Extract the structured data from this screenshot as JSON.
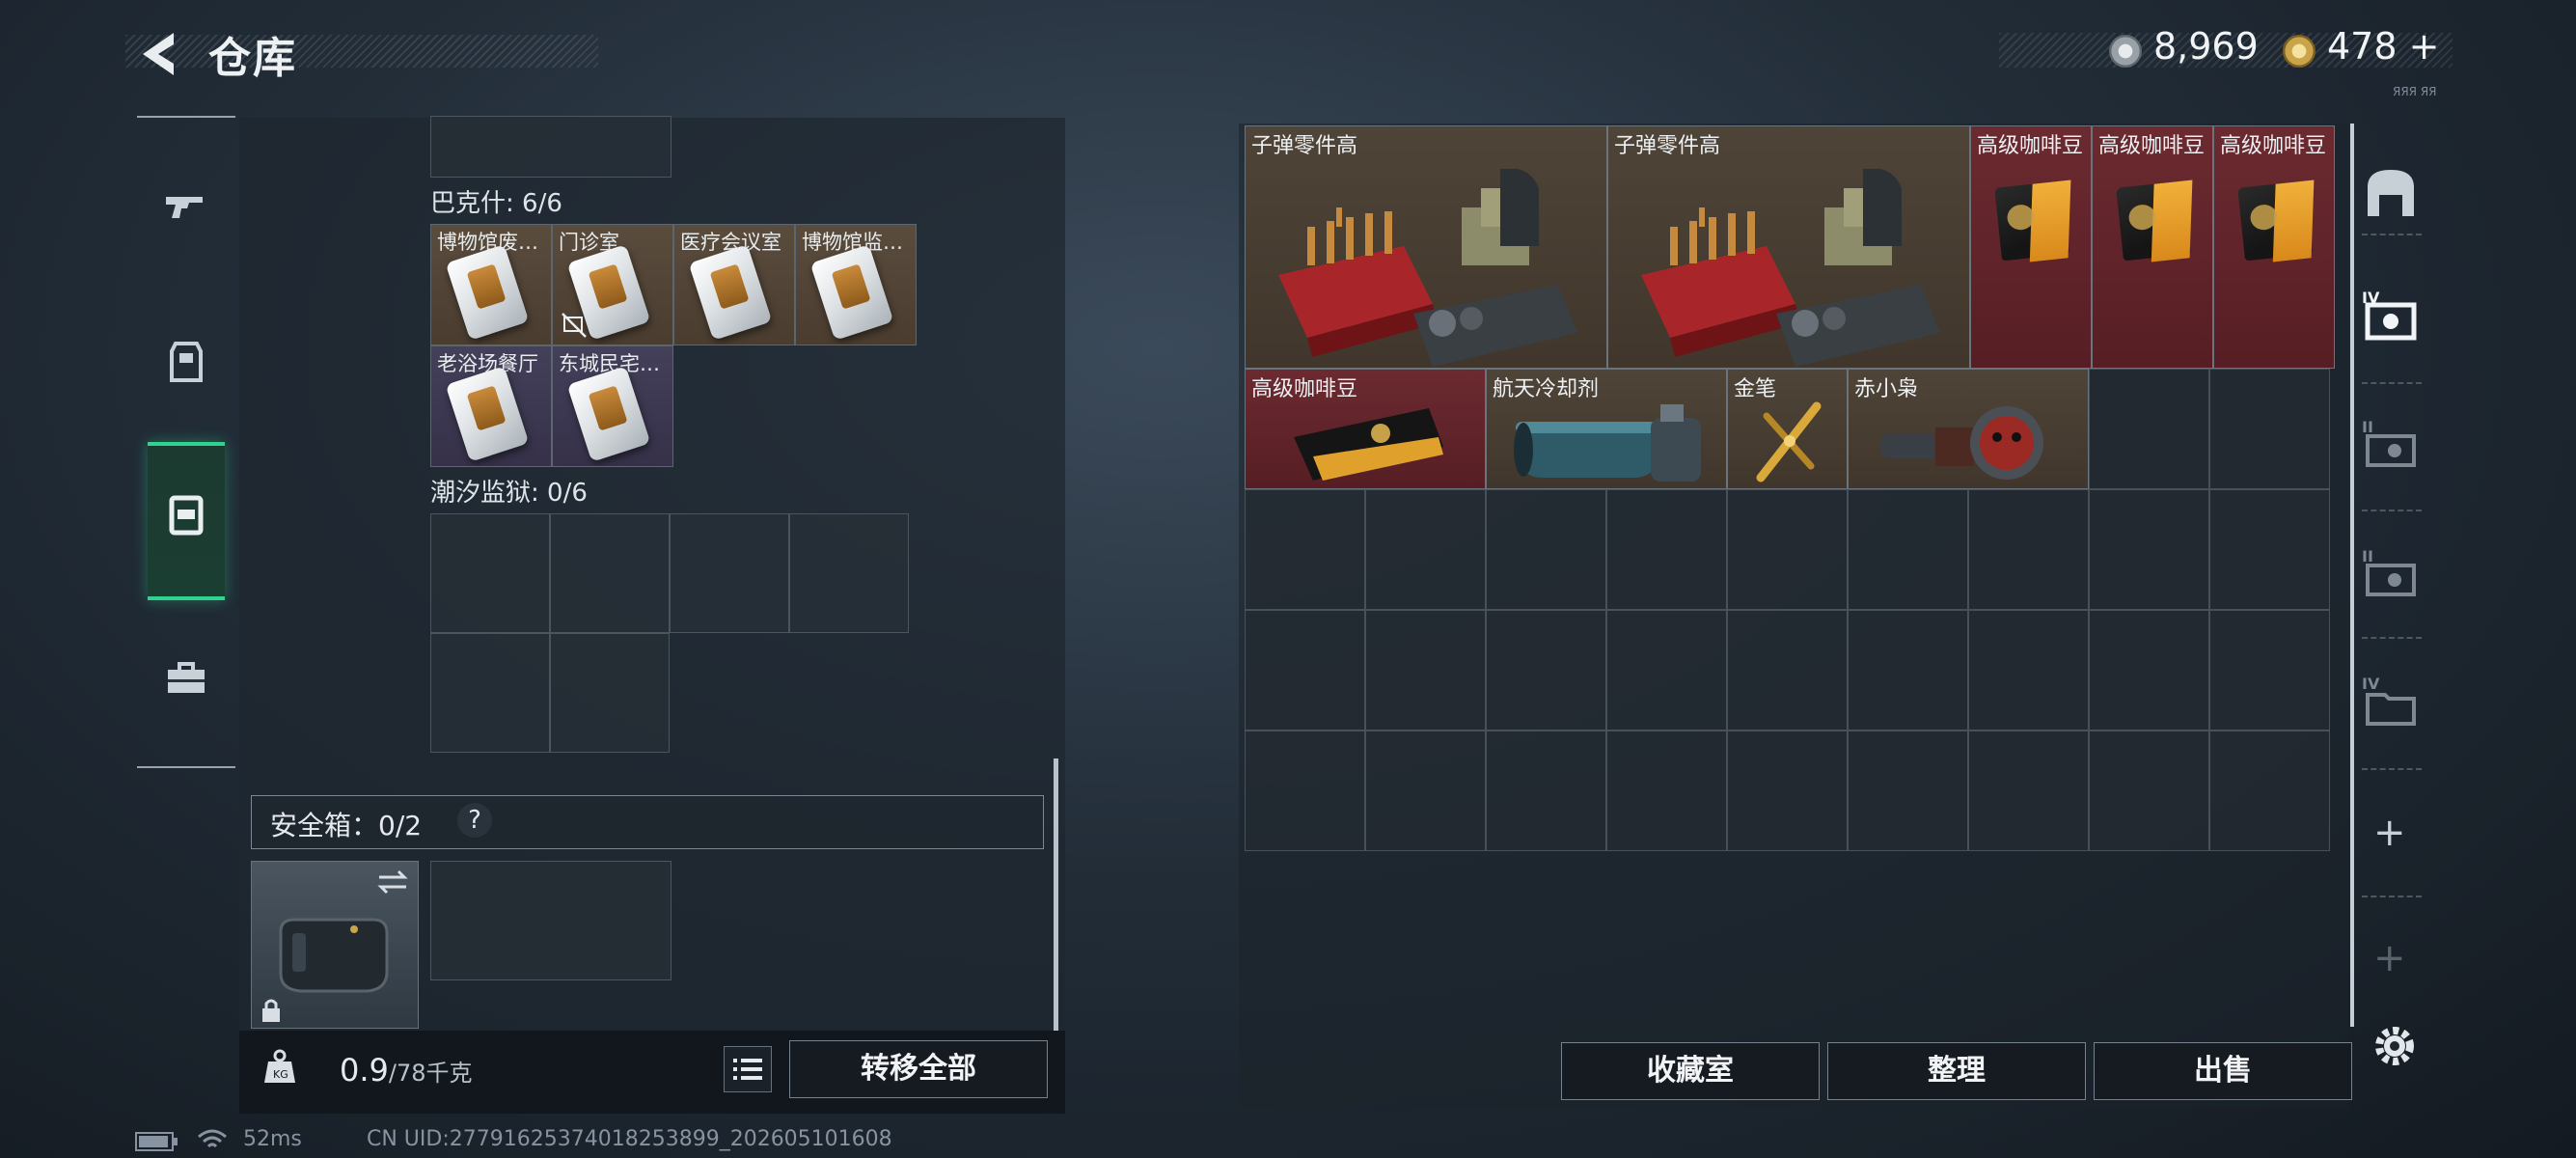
{
  "header": {
    "title": "仓库"
  },
  "currency": {
    "silver": "8,969",
    "gold": "478",
    "gold_plus": "+",
    "tiny_label": "ЯЯЯ ЯЯ"
  },
  "left_panel": {
    "section_bakeshi": {
      "label": "巴克什: 6/6"
    },
    "keycards": [
      {
        "name": "博物馆废…"
      },
      {
        "name": "门诊室"
      },
      {
        "name": "医疗会议室"
      },
      {
        "name": "博物馆监…"
      },
      {
        "name": "老浴场餐厅"
      },
      {
        "name": "东城民宅…"
      }
    ],
    "section_tide": {
      "label": "潮汐监狱: 0/6"
    },
    "safe": {
      "label": "安全箱：0/2",
      "help": "?"
    },
    "weight": {
      "current": "0.9",
      "max": "/78千克"
    },
    "transfer_all": "转移全部"
  },
  "right_panel": {
    "items": [
      {
        "name": "子弹零件高"
      },
      {
        "name": "子弹零件高"
      },
      {
        "name": "高级咖啡豆"
      },
      {
        "name": "高级咖啡豆"
      },
      {
        "name": "高级咖啡豆"
      },
      {
        "name": "高级咖啡豆"
      },
      {
        "name": "航天冷却剂"
      },
      {
        "name": "金笔"
      },
      {
        "name": "赤小枭"
      }
    ],
    "buttons": {
      "collection": "收藏室",
      "organize": "整理",
      "sell": "出售"
    }
  },
  "side_tabs": {
    "plus1": "+",
    "plus2": "+"
  },
  "status_bar": {
    "ping": "52ms",
    "uid": "CN UID:27791625374018253899_202605101608"
  },
  "colors": {
    "accent_green": "#2fd38e",
    "rarity_red": "#6b2a30",
    "rarity_tan": "#5a4c3d",
    "rarity_purple": "#44405a"
  }
}
